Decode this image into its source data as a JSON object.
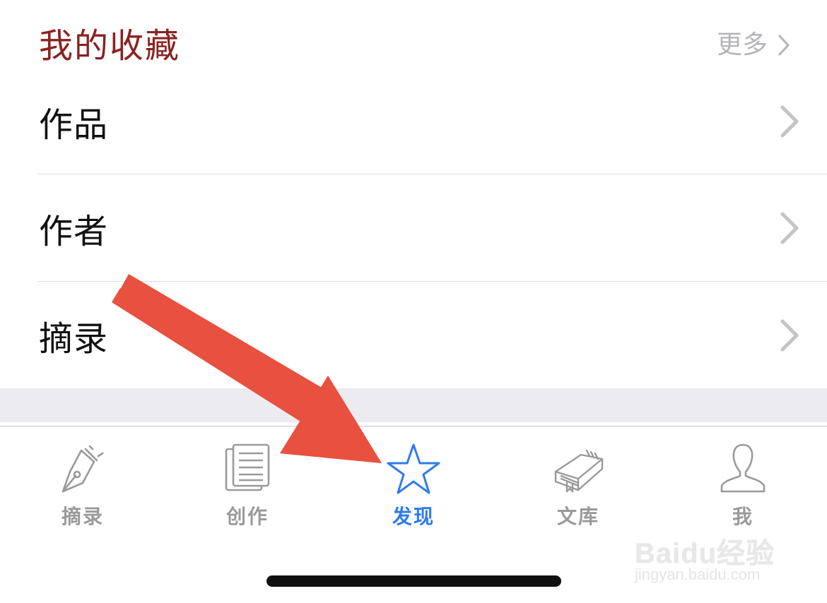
{
  "section": {
    "title": "我的收藏",
    "more_label": "更多",
    "more_icon": "chevron-right-icon"
  },
  "rows": [
    {
      "label": "作品",
      "icon": "chevron-right-icon"
    },
    {
      "label": "作者",
      "icon": "chevron-right-icon"
    },
    {
      "label": "摘录",
      "icon": "chevron-right-icon"
    }
  ],
  "tabbar": {
    "active_index": 2,
    "active_color": "#2f7bec",
    "inactive_color": "#9a9a9a",
    "tabs": [
      {
        "label": "摘录",
        "icon": "fountain-pen-icon"
      },
      {
        "label": "创作",
        "icon": "document-lines-icon"
      },
      {
        "label": "发现",
        "icon": "star-icon"
      },
      {
        "label": "文库",
        "icon": "book-icon"
      },
      {
        "label": "我",
        "icon": "person-icon"
      }
    ]
  },
  "annotation": {
    "arrow_color": "#e8503f",
    "arrow_icon": "red-arrow-pointing-to-discover-tab"
  },
  "watermark": {
    "logo": "Baidu经验",
    "url": "jingyan.baidu.com"
  },
  "colors": {
    "title_red": "#8b2222",
    "chevron_gray": "#c4c4c8",
    "separator": "#dcdce0",
    "band_gray": "#ececf0"
  }
}
